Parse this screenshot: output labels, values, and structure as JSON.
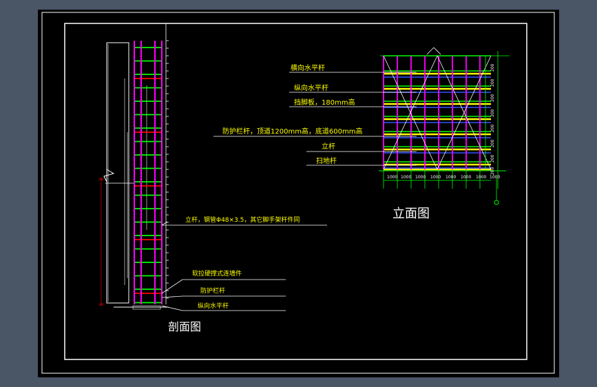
{
  "colors": {
    "background": "#000000",
    "chrome": "#4a5566",
    "frame": "#ffffff",
    "label": "#ffff00",
    "post": "#ff00ff",
    "ledger": "#00ff00",
    "guardrail": "#ff0000",
    "dim": "#00ff00",
    "bracing": "#ffffff",
    "toeboard": "#ffff00"
  },
  "section": {
    "title": "剖面图",
    "callouts": {
      "post": "立杆，钢管Φ48×3.5，其它脚手架杆件同",
      "tie": "软拉硬撑式连墙件",
      "guardrail": "防护栏杆",
      "ledger": "纵向水平杆"
    }
  },
  "elevation": {
    "title": "立面图",
    "callouts": {
      "transom": "横向水平杆",
      "ledger": "纵向水平杆",
      "toeboard": "挡脚板，180mm高",
      "guardrail": "防护栏杆，顶道1200mm高，底道600mm高",
      "post": "立杆",
      "sweep": "扫地杆"
    },
    "bay_labels": [
      "1000",
      "1000",
      "1000",
      "1000",
      "1000",
      "1000",
      "1000",
      "1000"
    ],
    "lift_labels": [
      "200",
      "200",
      "200",
      "200",
      "200",
      "200",
      "200",
      "200"
    ]
  }
}
